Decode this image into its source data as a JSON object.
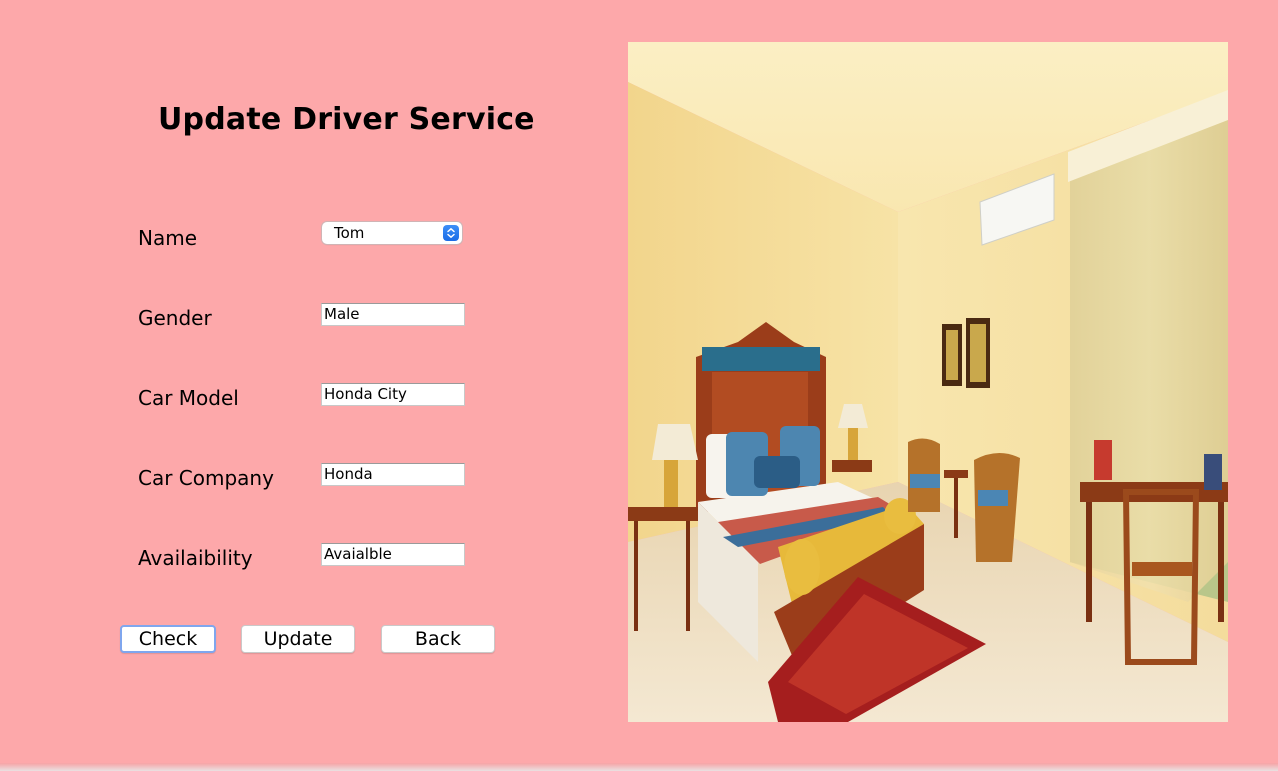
{
  "form": {
    "title": "Update Driver Service",
    "labels": {
      "name": "Name",
      "gender": "Gender",
      "car_model": "Car Model",
      "car_company": "Car Company",
      "availability": "Availaibility"
    },
    "values": {
      "name_selected": "Tom",
      "gender": "Male",
      "car_model": "Honda City",
      "car_company": "Honda",
      "availability": "Avaialble"
    }
  },
  "buttons": {
    "check": "Check",
    "update": "Update",
    "back": "Back"
  },
  "colors": {
    "background": "#fda8aa",
    "select_accent": "#2a7cf0",
    "focus_ring": "#7fa6ee"
  },
  "image": {
    "subject": "hotel-bedroom-photo"
  }
}
